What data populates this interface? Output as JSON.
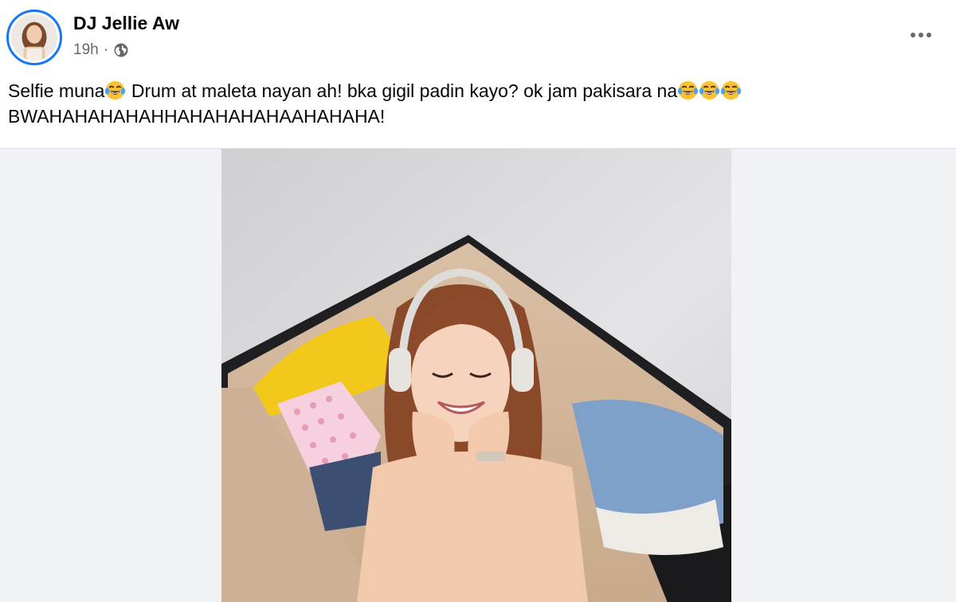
{
  "post": {
    "author": "DJ Jellie Aw",
    "timestamp": "19h",
    "separator": "·",
    "audience_icon": "globe-icon",
    "more_icon": "more-options-icon",
    "caption": {
      "line1_part1": "Selfie muna",
      "line1_part2": " Drum at maleta nayan ah! bka gigil padin kayo? ok jam pakisara na",
      "line2": "BWAHAHAHAHAHHAHAHAHAHAAHAHAHA!",
      "emoji": "face-with-tears-of-joy-icon"
    },
    "photo_alt_icon": "photo-woman-in-suitcase"
  },
  "colors": {
    "accent": "#1877f2",
    "secondary_text": "#65676b",
    "media_bg": "#f0f2f5"
  }
}
